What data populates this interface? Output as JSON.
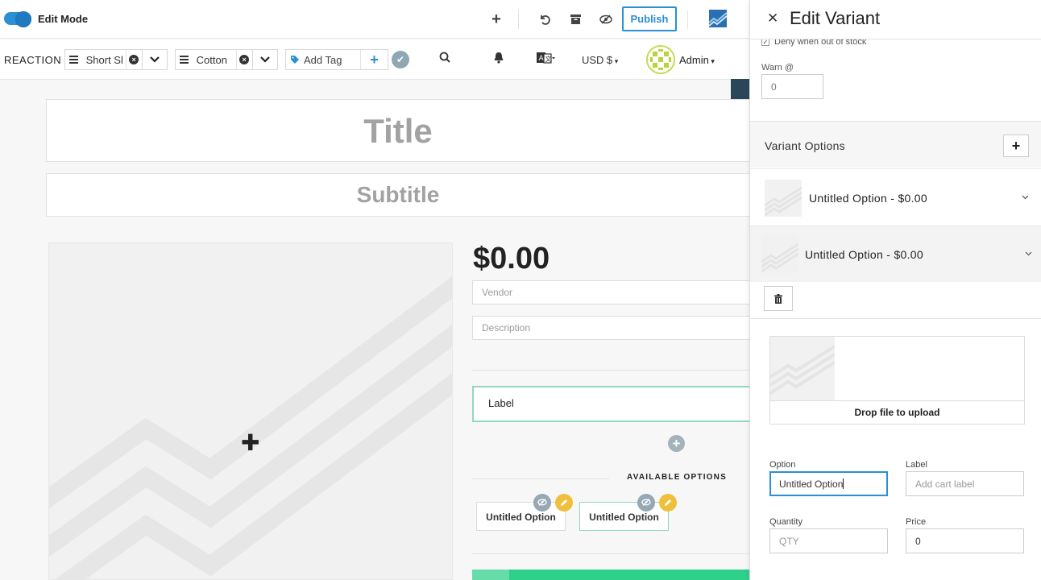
{
  "topbar": {
    "edit_mode_label": "Edit Mode",
    "publish_label": "Publish"
  },
  "subbar": {
    "brand_text": "REACTION",
    "tag1": "Short Sl",
    "tag2": "Cotton",
    "add_tag_placeholder": "Add Tag",
    "currency": "USD $",
    "user_name": "Admin"
  },
  "product": {
    "title": "Title",
    "subtitle": "Subtitle",
    "price": "$0.00",
    "vendor_placeholder": "Vendor",
    "description_placeholder": "Description",
    "label_text": "Label",
    "available_options_title": "AVAILABLE OPTIONS",
    "options": [
      "Untitled Option",
      "Untitled Option"
    ]
  },
  "panel": {
    "title": "Edit Variant",
    "deny_label": "Deny when out of stock",
    "warn_label": "Warn @",
    "warn_value": "0",
    "variant_options_title": "Variant Options",
    "variant_rows": [
      "Untitled Option - $0.00",
      "Untitled Option - $0.00"
    ],
    "drop_label": "Drop file to upload",
    "option_label": "Option",
    "option_value": "Untitled Option",
    "label_label": "Label",
    "label_placeholder": "Add cart label",
    "quantity_label": "Quantity",
    "quantity_placeholder": "QTY",
    "price_label": "Price",
    "price_value": "0"
  },
  "colors": {
    "accent_blue": "#2b8fd4",
    "teal_border": "#8fd8c3",
    "green": "#2fd08a",
    "pen_yellow": "#f0bf3c"
  },
  "icons": [
    "plus-icon",
    "undo-icon",
    "archive-icon",
    "eye-slash-icon",
    "search-icon",
    "bell-icon",
    "translate-icon",
    "tag-icon",
    "check-icon",
    "close-icon",
    "trash-icon",
    "chevron-down-icon",
    "pencil-icon"
  ]
}
